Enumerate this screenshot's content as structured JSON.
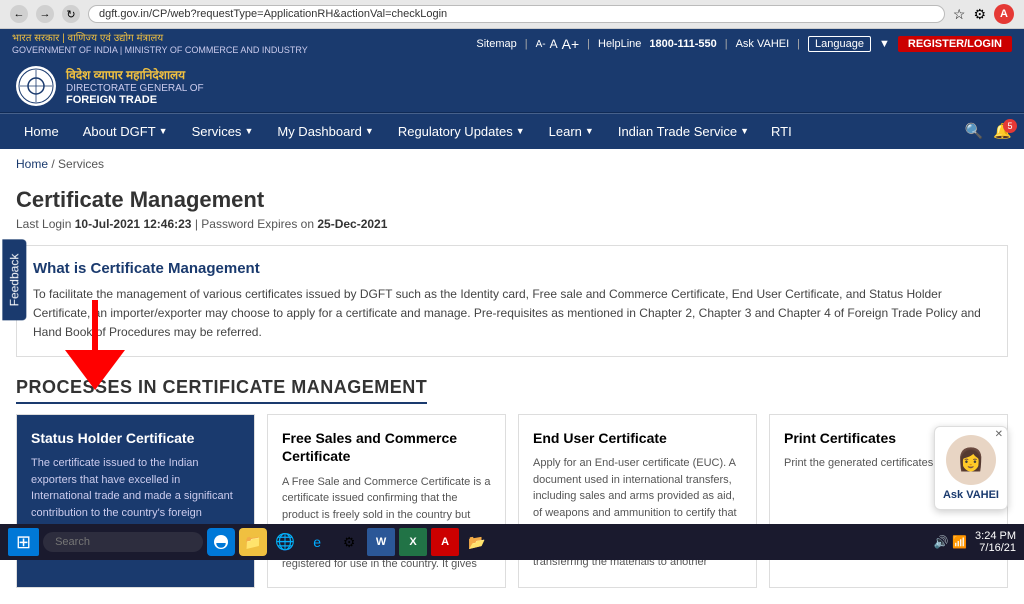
{
  "browser": {
    "url": "dgft.gov.in/CP/web?requestType=ApplicationRH&actionVal=checkLogin",
    "back_title": "Back",
    "forward_title": "Forward",
    "refresh_title": "Refresh"
  },
  "utility_bar": {
    "gov_text": "भारत सरकार | वाणिज्य एवं उद्योग मंत्रालय",
    "gov_sub": "GOVERNMENT OF INDIA | MINISTRY OF COMMERCE AND INDUSTRY",
    "sitemap": "Sitemap",
    "font_small": "A-",
    "font_normal": "A",
    "font_large": "A+",
    "helpline_label": "HelpLine",
    "helpline_number": "1800-111-550",
    "ask_vahei": "Ask VAHEI",
    "language": "Language",
    "register_label": "REGISTER/LOGIN"
  },
  "header": {
    "logo_line1": "विदेश व्यापार महानिदेशालय",
    "logo_line2": "DIRECTORATE GENERAL OF",
    "logo_line3": "FOREIGN TRADE"
  },
  "nav": {
    "home": "Home",
    "about": "About DGFT",
    "services": "Services",
    "dashboard": "My Dashboard",
    "regulatory": "Regulatory Updates",
    "learn": "Learn",
    "trade": "Indian Trade Service",
    "rti": "RTI",
    "notification_count": "5"
  },
  "breadcrumb": {
    "home": "Home",
    "separator": "/",
    "current": "Services"
  },
  "page": {
    "title": "Certificate Management",
    "login_date": "10-Jul-2021 12:46:23",
    "password_expiry": "25-Dec-2021",
    "login_prefix": "Last Login",
    "password_prefix": "Password Expires on"
  },
  "description": {
    "title": "What is Certificate Management",
    "text": "To facilitate the management of various certificates issued by DGFT such as the Identity card, Free sale and Commerce Certificate, End User Certificate, and Status Holder Certificate, an importer/exporter may choose to apply for a certificate and manage. Pre-requisites as mentioned in Chapter 2, Chapter 3 and Chapter 4 of Foreign Trade Policy and Hand Book of Procedures may be referred."
  },
  "processes": {
    "title": "PROCESSES IN CERTIFICATE MANAGEMENT",
    "cards": [
      {
        "title": "Status Holder Certificate",
        "text": "The certificate issued to the Indian exporters that have excelled in International trade and made a significant contribution to the country's foreign exchange earnings. The certificate is issued to the exporters having",
        "active": true
      },
      {
        "title": "Free Sales and Commerce Certificate",
        "text": "A Free Sale and Commerce Certificate is a certificate issued confirming that the product is freely sold in the country but without any indication that the product is evaluated for safety and efficacy and is registered for use in the country. It gives",
        "active": false
      },
      {
        "title": "End User Certificate",
        "text": "Apply for an End-user certificate (EUC). A document used in international transfers, including sales and arms provided as aid, of weapons and ammunition to certify that the buyer is the final recipient of the materials, and is not planning on transferring the materials to another",
        "active": false
      },
      {
        "title": "Print Certificates",
        "text": "Print the generated certificates.",
        "active": false
      }
    ]
  },
  "feedback": {
    "label": "Feedback"
  },
  "ask_vahei_widget": {
    "label": "Ask VAHEI"
  },
  "taskbar": {
    "time": "3:24 PM",
    "date": "7/16/21"
  }
}
